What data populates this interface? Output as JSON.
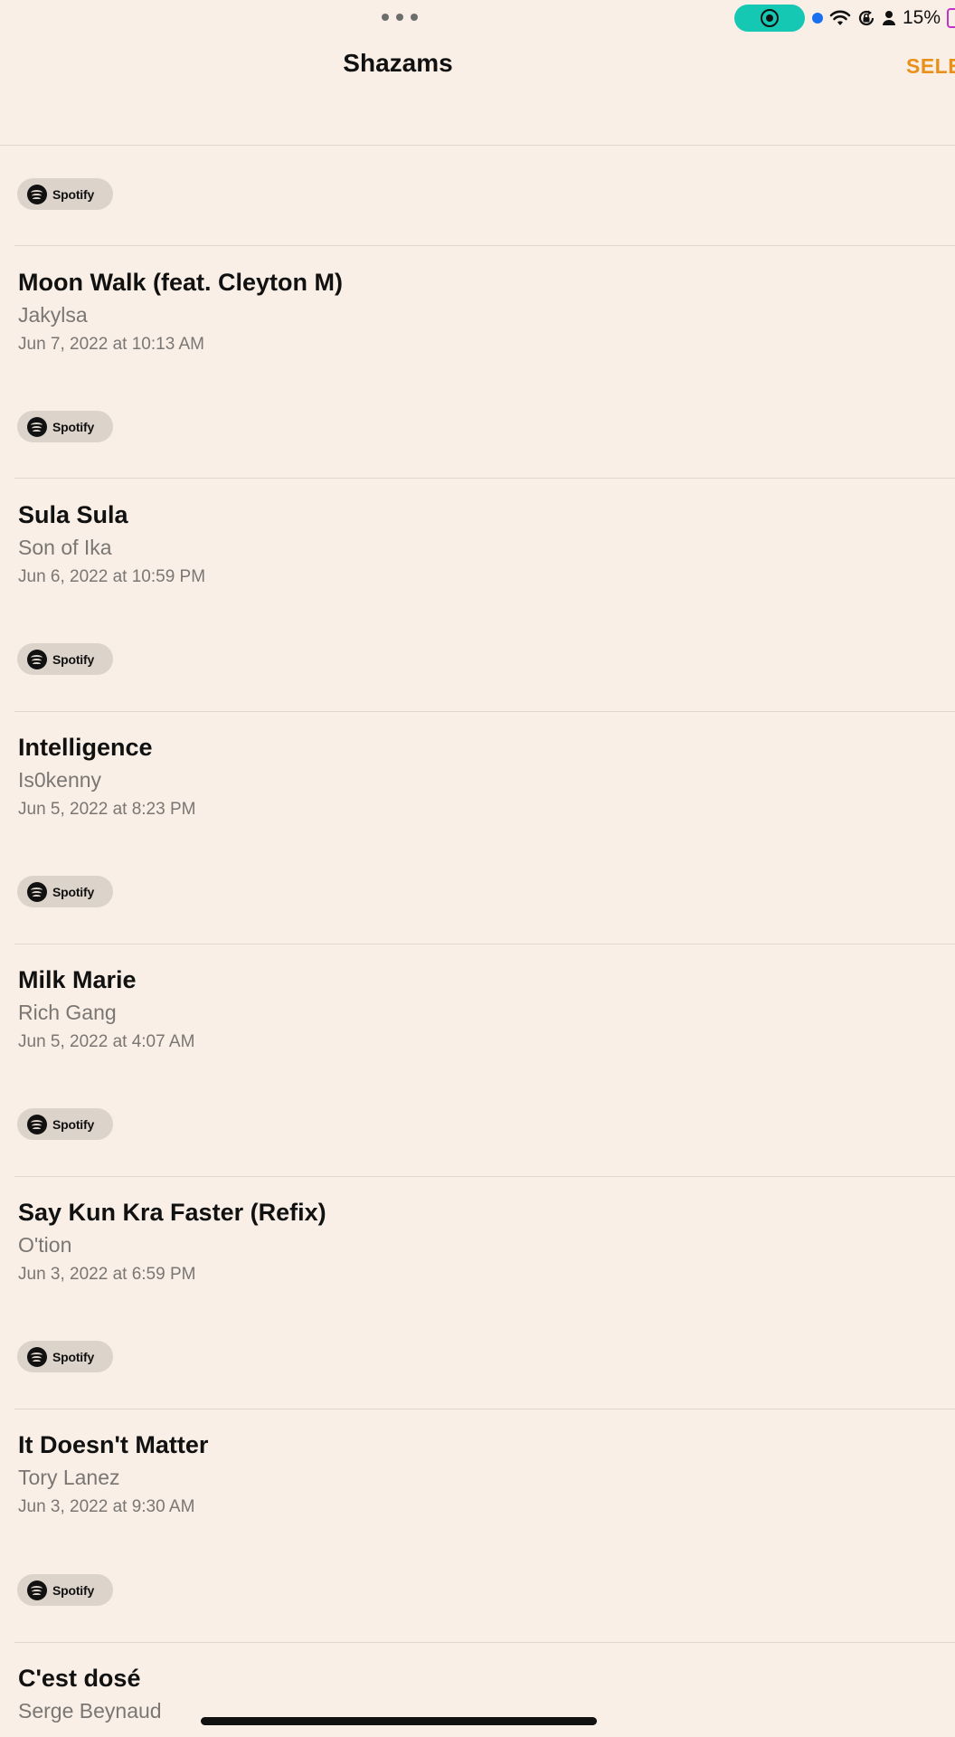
{
  "status_bar": {
    "battery_percent": "15%",
    "icons": [
      "more-dots-icon",
      "screen-record-icon",
      "location-dot-icon",
      "wifi-icon",
      "orientation-lock-icon",
      "person-icon",
      "battery-icon"
    ],
    "record_pill_color": "#14c8b4",
    "battery_color": "#c233c9"
  },
  "nav": {
    "title": "Shazams",
    "select_label": "SELE",
    "accent_color": "#e9901b"
  },
  "badge": {
    "label": "Spotify",
    "icon": "spotify-icon"
  },
  "tracks": [
    {
      "title": "Moon Walk (feat. Cleyton M)",
      "artist": "Jakylsa",
      "date": "Jun 7, 2022 at 10:13 AM"
    },
    {
      "title": "Sula Sula",
      "artist": "Son of Ika",
      "date": "Jun 6, 2022 at 10:59 PM"
    },
    {
      "title": "Intelligence",
      "artist": "Is0kenny",
      "date": "Jun 5, 2022 at 8:23 PM"
    },
    {
      "title": "Milk Marie",
      "artist": "Rich Gang",
      "date": "Jun 5, 2022 at 4:07 AM"
    },
    {
      "title": "Say Kun Kra Faster (Refix)",
      "artist": "O'tion",
      "date": "Jun 3, 2022 at 6:59 PM"
    },
    {
      "title": "It Doesn't Matter",
      "artist": "Tory Lanez",
      "date": "Jun 3, 2022 at 9:30 AM"
    },
    {
      "title": "C'est dosé",
      "artist": "Serge Beynaud",
      "date": ""
    }
  ]
}
